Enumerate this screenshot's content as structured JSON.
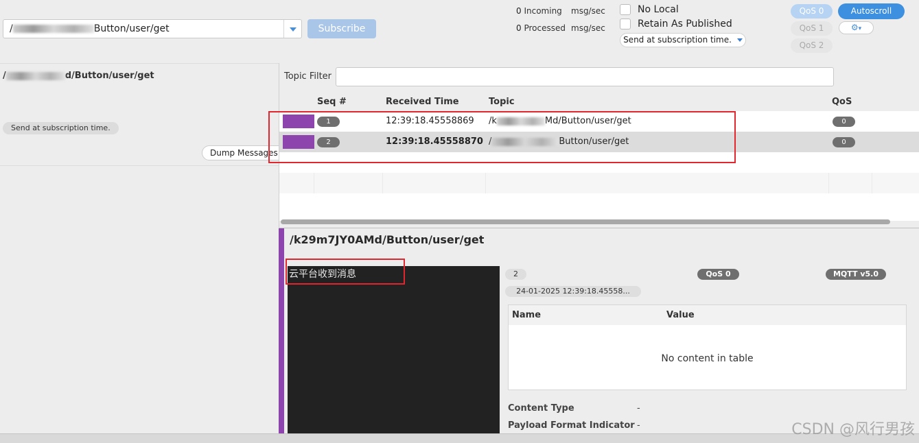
{
  "toolbar": {
    "topic_prefix": "/",
    "topic_suffix": "Button/user/get",
    "subscribe_label": "Subscribe",
    "incoming_count": "0",
    "incoming_label": "Incoming",
    "processed_count": "0",
    "processed_label": "Processed",
    "rate_unit": "msg/sec",
    "no_local_label": "No Local",
    "retain_label": "Retain As Published",
    "send_option": "Send at subscription time.",
    "qos0": "QoS 0",
    "qos1": "QoS 1",
    "qos2": "QoS 2",
    "autoscroll": "Autoscroll"
  },
  "left": {
    "topic_prefix": "/",
    "topic_suffix": "d/Button/user/get",
    "send_option": "Send at subscription time.",
    "dump_label": "Dump Messages (J"
  },
  "messages": {
    "filter_label": "Topic Filter",
    "col_seq": "Seq #",
    "col_time": "Received Time",
    "col_topic": "Topic",
    "col_qos": "QoS",
    "rows": [
      {
        "seq": "1",
        "time": "12:39:18.45558869",
        "topic_prefix": "/k",
        "topic_suffix": "Md/Button/user/get",
        "qos": "0"
      },
      {
        "seq": "2",
        "time": "12:39:18.45558870",
        "topic_prefix": "/",
        "topic_suffix": "Button/user/get",
        "qos": "0"
      }
    ]
  },
  "detail": {
    "title": "/k29m7JY0AMd/Button/user/get",
    "payload": "云平台收到消息",
    "seq": "2",
    "qos": "QoS 0",
    "protocol": "MQTT v5.0",
    "timestamp": "24-01-2025  12:39:18.45558...",
    "col_name": "Name",
    "col_value": "Value",
    "empty_text": "No content in table",
    "content_type_label": "Content Type",
    "content_type_value": "-",
    "payload_format_label": "Payload Format Indicator",
    "payload_format_value": "-"
  },
  "watermark": "CSDN @风行男孩",
  "colors": {
    "accent_blue": "#3d8fe0",
    "message_color": "#8e44ad",
    "highlight_red": "#e0262e"
  }
}
